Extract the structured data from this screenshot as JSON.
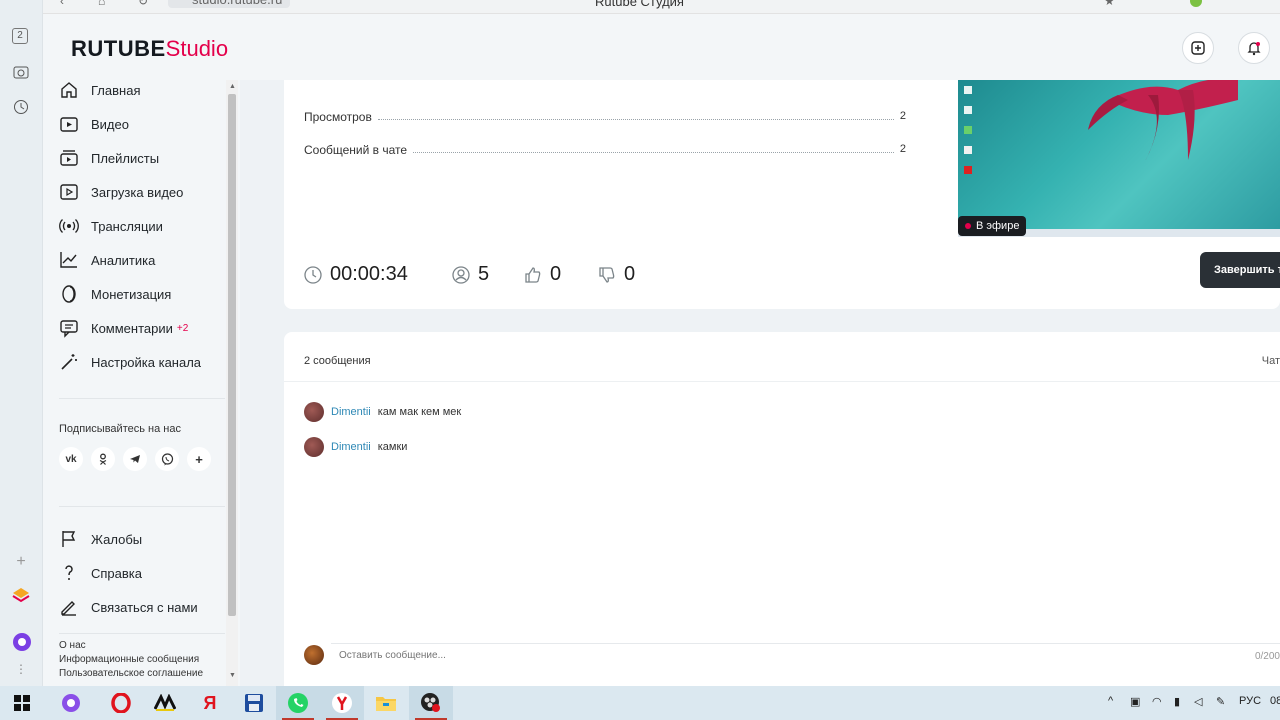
{
  "browser": {
    "url": "studio.rutube.ru",
    "title": "Rutube Студия"
  },
  "header": {
    "logo_main": "RUTUBE",
    "logo_studio": "Studio"
  },
  "sidebar": {
    "items": [
      {
        "label": "Главная",
        "icon": "home-icon"
      },
      {
        "label": "Видео",
        "icon": "video-icon"
      },
      {
        "label": "Плейлисты",
        "icon": "playlist-icon"
      },
      {
        "label": "Загрузка видео",
        "icon": "upload-icon"
      },
      {
        "label": "Трансляции",
        "icon": "broadcast-icon"
      },
      {
        "label": "Аналитика",
        "icon": "chart-icon"
      },
      {
        "label": "Монетизация",
        "icon": "coin-icon"
      },
      {
        "label": "Комментарии",
        "icon": "comment-icon",
        "badge": "+2"
      },
      {
        "label": "Настройка канала",
        "icon": "wand-icon"
      }
    ],
    "social_title": "Подписывайтесь на нас",
    "social": [
      "vk",
      "ok",
      "telegram",
      "viber",
      "more"
    ],
    "bottom_items": [
      {
        "label": "Жалобы",
        "icon": "flag-icon"
      },
      {
        "label": "Справка",
        "icon": "help-icon"
      },
      {
        "label": "Связаться с нами",
        "icon": "pencil-icon"
      }
    ],
    "footer_links": [
      "О нас",
      "Информационные сообщения",
      "Пользовательское соглашение"
    ]
  },
  "stats": {
    "views_label": "Просмотров",
    "views_value": "2",
    "chat_label": "Сообщений в чате",
    "chat_value": "2"
  },
  "preview": {
    "live_label": "В эфире"
  },
  "metrics": {
    "duration": "00:00:34",
    "viewers": "5",
    "likes": "0",
    "dislikes": "0"
  },
  "end_button": "Завершить трансляцию",
  "chat": {
    "count_label": "2 сообщения",
    "right_label": "Чат",
    "messages": [
      {
        "user": "Dimentii",
        "text": "кам мак кем мек"
      },
      {
        "user": "Dimentii",
        "text": "камки"
      }
    ],
    "input_placeholder": "Оставить сообщение...",
    "limit": "0/200"
  },
  "taskbar": {
    "lang": "РУС",
    "time": "08"
  },
  "colors": {
    "brand": "#e4004b",
    "link": "#2e88b5",
    "dark_button": "#2a3036"
  }
}
